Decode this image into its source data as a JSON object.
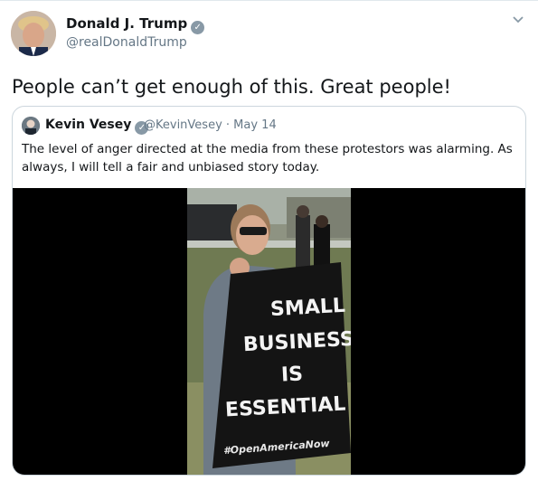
{
  "tweet": {
    "author_name": "Donald J. Trump",
    "handle": "@realDonaldTrump",
    "text": "People can’t get enough of this. Great people!",
    "verified_icon": "verified-badge-icon",
    "menu_icon": "chevron-down-icon"
  },
  "quote": {
    "author_name": "Kevin Vesey",
    "handle_date": "@KevinVesey · May 14",
    "text": "The level of anger directed at the media from these protestors was alarming. As always, I will tell a fair and unbiased story today.",
    "media": {
      "sign_lines": [
        "SMALL",
        "BUSINESS",
        "IS",
        "ESSENTIAL"
      ],
      "hashtag": "#OpenAmericaNow"
    }
  },
  "colors": {
    "text": "#14171a",
    "secondary": "#657786",
    "border": "#ccd6dd",
    "media_bg": "#000000"
  }
}
